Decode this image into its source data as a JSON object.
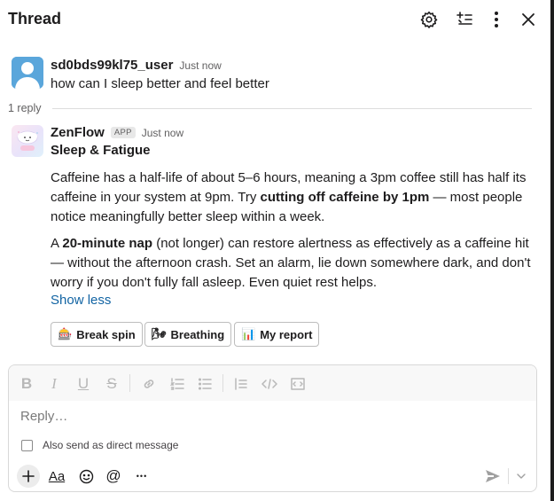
{
  "header": {
    "title": "Thread",
    "icons": [
      "gear-icon",
      "sparkle-list-icon",
      "more-vertical-icon",
      "close-icon"
    ]
  },
  "parent_message": {
    "sender": "sd0bds99kl75_user",
    "timestamp": "Just now",
    "text": "how can I sleep better and feel better"
  },
  "reply_count": "1 reply",
  "bot_message": {
    "sender": "ZenFlow",
    "badge": "APP",
    "timestamp": "Just now",
    "title": "Sleep & Fatigue",
    "para1": {
      "before": "Caffeine has a half-life of about 5–6 hours, meaning a 3pm coffee still has half its caffeine in your system at 9pm. Try ",
      "bold": "cutting off caffeine by 1pm",
      "after": " — most people notice meaningfully better sleep within a week."
    },
    "para2": {
      "before": "A ",
      "bold": "20-minute nap",
      "after": " (not longer) can restore alertness as effectively as a caffeine hit — without the afternoon crash. Set an alarm, lie down somewhere dark, and don't worry if you don't fully fall asleep. Even quiet rest helps."
    },
    "show_less": "Show less",
    "actions": [
      {
        "emoji": "🎰",
        "label": "Break spin"
      },
      {
        "emoji": "🌬",
        "label": "Breathing"
      },
      {
        "emoji": "📊",
        "label": "My report"
      }
    ]
  },
  "composer": {
    "placeholder": "Reply…",
    "dm_label": "Also send as direct message",
    "format_icons": [
      "bold-icon",
      "italic-icon",
      "underline-icon",
      "strikethrough-icon",
      "link-icon",
      "ordered-list-icon",
      "bulleted-list-icon",
      "quote-icon",
      "code-icon",
      "code-block-icon"
    ],
    "bold_glyph": "B",
    "italic_glyph": "I",
    "underline_glyph": "U",
    "strike_glyph": "S",
    "aa_label": "Aa",
    "at_glyph": "@",
    "more_glyph": "•••"
  },
  "colors": {
    "link": "#1264a3",
    "text": "#1d1c1d",
    "muted": "#616061"
  }
}
